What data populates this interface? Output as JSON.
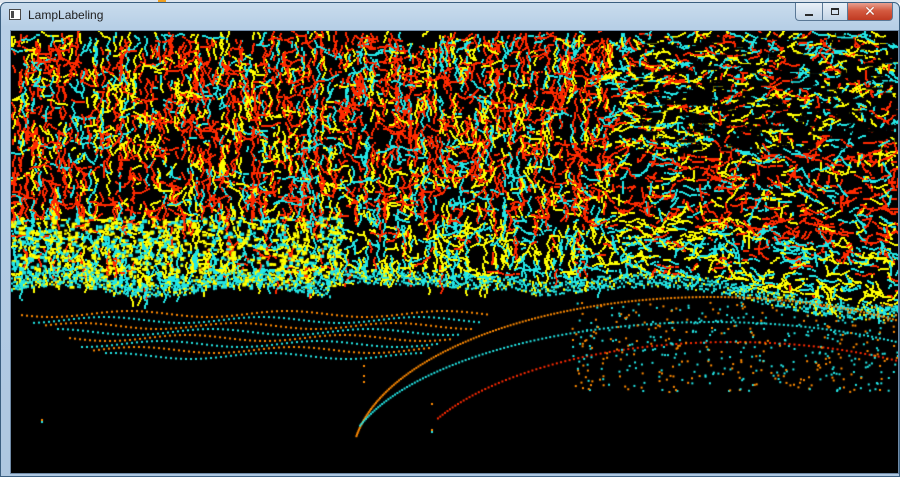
{
  "window": {
    "title": "LampLabeling",
    "icon": "app-window-icon"
  },
  "caption_buttons": {
    "minimize": "minimize-icon",
    "maximize": "maximize-icon",
    "close": "close-icon",
    "close_glyph": "✕"
  },
  "point_cloud": {
    "background": "#000000",
    "colors": {
      "red": "#ff2a00",
      "yellow": "#ffff00",
      "cyan": "#22e6e6",
      "orange": "#ff8a00"
    }
  }
}
